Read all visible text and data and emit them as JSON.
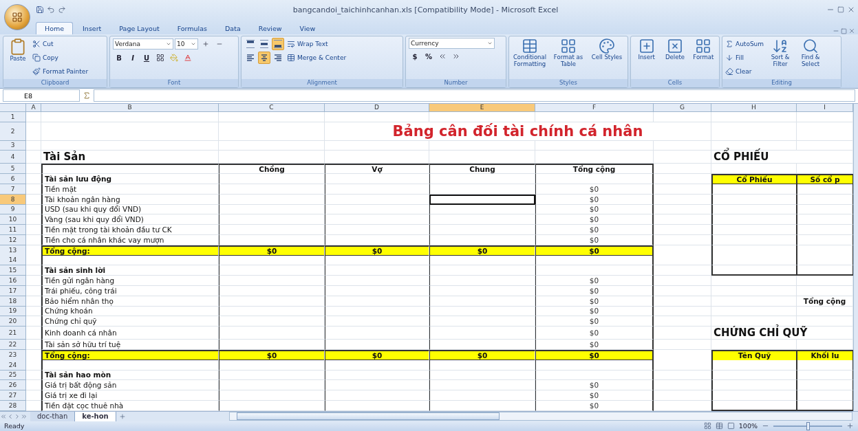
{
  "window": {
    "title": "bangcandoi_taichinhcanhan.xls  [Compatibility Mode] - Microsoft Excel"
  },
  "ribbon": {
    "tabs": [
      {
        "label": "Home",
        "selected": true
      },
      {
        "label": "Insert",
        "selected": false
      },
      {
        "label": "Page Layout",
        "selected": false
      },
      {
        "label": "Formulas",
        "selected": false
      },
      {
        "label": "Data",
        "selected": false
      },
      {
        "label": "Review",
        "selected": false
      },
      {
        "label": "View",
        "selected": false
      }
    ],
    "groups": [
      {
        "kind": "clipboard",
        "label": "Clipboard",
        "large": [
          "Paste"
        ],
        "small": [
          "Cut",
          "Copy",
          "Format Painter"
        ]
      },
      {
        "kind": "font",
        "label": "Font",
        "font": "Verdana",
        "size": "10",
        "styles": [
          "B",
          "I",
          "U"
        ]
      },
      {
        "kind": "alignment",
        "label": "Alignment",
        "vertical": [
          {
            "selected": false
          },
          {
            "selected": false
          },
          {
            "selected": true
          }
        ],
        "horizontal": [
          {
            "selected": false
          },
          {
            "selected": true
          },
          {
            "selected": false
          }
        ],
        "small": [
          "Wrap Text",
          "Merge & Center"
        ]
      },
      {
        "kind": "number",
        "label": "Number",
        "format": "Currency",
        "symbols": [
          "$",
          "%"
        ]
      },
      {
        "kind": "styles",
        "label": "Styles",
        "large": [
          "Conditional Formatting",
          "Format as Table",
          "Cell Styles"
        ]
      },
      {
        "kind": "cells",
        "label": "Cells",
        "large": [
          "Insert",
          "Delete",
          "Format"
        ]
      },
      {
        "kind": "editing",
        "label": "Editing",
        "small": [
          "AutoSum",
          "Fill",
          "Clear"
        ],
        "large": [
          "Sort & Filter",
          "Find & Select"
        ]
      }
    ]
  },
  "formula_bar": {
    "name_box": "E8"
  },
  "columns": [
    {
      "label": "A",
      "selected": false
    },
    {
      "label": "B",
      "selected": false
    },
    {
      "label": "C",
      "selected": false
    },
    {
      "label": "D",
      "selected": false
    },
    {
      "label": "E",
      "selected": true
    },
    {
      "label": "F",
      "selected": false
    },
    {
      "label": "G",
      "selected": false
    },
    {
      "label": "H",
      "selected": false
    },
    {
      "label": "I",
      "selected": false
    }
  ],
  "rows": [
    {
      "number": "1",
      "selected": false,
      "side_frame": false,
      "cells": {}
    },
    {
      "number": "2",
      "selected": false,
      "side_frame": false,
      "cells": {
        "d": {
          "text": "Bảng cân đối tài chính cá nhân",
          "kind": "title"
        }
      }
    },
    {
      "number": "3",
      "selected": false,
      "side_frame": false,
      "cells": {}
    },
    {
      "number": "4",
      "selected": false,
      "side_frame": false,
      "cells": {
        "b": {
          "text": "Tài Sản",
          "kind": "heading"
        },
        "h": {
          "text": "CỔ PHIẾU",
          "kind": "side_heading"
        }
      }
    },
    {
      "number": "5",
      "selected": false,
      "side_frame": false,
      "cells": {
        "c": {
          "text": "Chồng",
          "kind": "col_header"
        },
        "d": {
          "text": "Vợ",
          "kind": "col_header"
        },
        "e": {
          "text": "Chung",
          "kind": "col_header"
        },
        "f": {
          "text": "Tổng cộng",
          "kind": "col_header"
        }
      }
    },
    {
      "number": "6",
      "selected": false,
      "side_frame": false,
      "cells": {
        "b": {
          "text": "Tài sản lưu động",
          "kind": "section"
        },
        "h": {
          "text": "Cổ Phiếu",
          "kind": "side_header"
        },
        "i": {
          "text": "Số cổ p",
          "kind": "side_header"
        }
      }
    },
    {
      "number": "7",
      "selected": false,
      "side_frame": true,
      "cells": {
        "b": {
          "text": "Tiền mặt",
          "kind": "label"
        },
        "f": {
          "text": "$0",
          "kind": "value"
        }
      }
    },
    {
      "number": "8",
      "selected": true,
      "side_frame": true,
      "cells": {
        "b": {
          "text": "Tài khoản ngân hàng",
          "kind": "label"
        },
        "f": {
          "text": "$0",
          "kind": "value"
        }
      }
    },
    {
      "number": "9",
      "selected": false,
      "side_frame": true,
      "cells": {
        "b": {
          "text": "USD (sau khi quy đổi VND)",
          "kind": "label"
        },
        "f": {
          "text": "$0",
          "kind": "value"
        }
      }
    },
    {
      "number": "10",
      "selected": false,
      "side_frame": true,
      "cells": {
        "b": {
          "text": "Vàng (sau khi quy đổi VND)",
          "kind": "label"
        },
        "f": {
          "text": "$0",
          "kind": "value"
        }
      }
    },
    {
      "number": "11",
      "selected": false,
      "side_frame": true,
      "cells": {
        "b": {
          "text": "Tiền mặt trong tài khoản đầu tư CK",
          "kind": "label"
        },
        "f": {
          "text": "$0",
          "kind": "value"
        }
      }
    },
    {
      "number": "12",
      "selected": false,
      "side_frame": true,
      "cells": {
        "b": {
          "text": "Tiền cho cá nhân khác vay mượn",
          "kind": "label"
        },
        "f": {
          "text": "$0",
          "kind": "value"
        }
      }
    },
    {
      "number": "13",
      "selected": false,
      "side_frame": true,
      "cells": {
        "b": {
          "text": "Tổng cộng:",
          "kind": "total_label"
        },
        "c": {
          "text": "$0",
          "kind": "total_value"
        },
        "d": {
          "text": "$0",
          "kind": "total_value"
        },
        "e": {
          "text": "$0",
          "kind": "total_value"
        },
        "f": {
          "text": "$0",
          "kind": "total_value"
        }
      }
    },
    {
      "number": "14",
      "selected": false,
      "side_frame": true,
      "cells": {}
    },
    {
      "number": "15",
      "selected": false,
      "side_frame": true,
      "cells": {
        "b": {
          "text": "Tài sản sinh lời",
          "kind": "section"
        }
      }
    },
    {
      "number": "16",
      "selected": false,
      "side_frame": false,
      "cells": {
        "b": {
          "text": "Tiền gửi ngân hàng",
          "kind": "label"
        },
        "f": {
          "text": "$0",
          "kind": "value"
        }
      }
    },
    {
      "number": "17",
      "selected": false,
      "side_frame": false,
      "cells": {
        "b": {
          "text": "Trái phiếu, công trái",
          "kind": "label"
        },
        "f": {
          "text": "$0",
          "kind": "value"
        }
      }
    },
    {
      "number": "18",
      "selected": false,
      "side_frame": false,
      "cells": {
        "b": {
          "text": "Bảo hiểm nhân thọ",
          "kind": "label"
        },
        "f": {
          "text": "$0",
          "kind": "value"
        },
        "i": {
          "text": "Tổng cộng",
          "kind": "side_label"
        }
      }
    },
    {
      "number": "19",
      "selected": false,
      "side_frame": false,
      "cells": {
        "b": {
          "text": "Chứng khoán",
          "kind": "label"
        },
        "f": {
          "text": "$0",
          "kind": "value"
        }
      }
    },
    {
      "number": "20",
      "selected": false,
      "side_frame": false,
      "cells": {
        "b": {
          "text": "Chứng chỉ quỹ",
          "kind": "label"
        },
        "f": {
          "text": "$0",
          "kind": "value"
        }
      }
    },
    {
      "number": "21",
      "selected": false,
      "side_frame": false,
      "cells": {
        "b": {
          "text": "Kinh doanh cá nhân",
          "kind": "label"
        },
        "f": {
          "text": "$0",
          "kind": "value"
        },
        "h": {
          "text": "CHỨNG CHỈ QUỸ",
          "kind": "side_heading"
        }
      }
    },
    {
      "number": "22",
      "selected": false,
      "side_frame": false,
      "cells": {
        "b": {
          "text": "Tài sản sở hữu trí tuệ",
          "kind": "label"
        },
        "f": {
          "text": "$0",
          "kind": "value"
        }
      }
    },
    {
      "number": "23",
      "selected": false,
      "side_frame": false,
      "cells": {
        "b": {
          "text": "Tổng cộng:",
          "kind": "total_label"
        },
        "c": {
          "text": "$0",
          "kind": "total_value"
        },
        "d": {
          "text": "$0",
          "kind": "total_value"
        },
        "e": {
          "text": "$0",
          "kind": "total_value"
        },
        "f": {
          "text": "$0",
          "kind": "total_value"
        },
        "h": {
          "text": "Tên Quỹ",
          "kind": "side_header"
        },
        "i": {
          "text": "Khối lu",
          "kind": "side_header"
        }
      }
    },
    {
      "number": "24",
      "selected": false,
      "side_frame": true,
      "cells": {}
    },
    {
      "number": "25",
      "selected": false,
      "side_frame": true,
      "cells": {
        "b": {
          "text": "Tài sản hao mòn",
          "kind": "section"
        }
      }
    },
    {
      "number": "26",
      "selected": false,
      "side_frame": true,
      "cells": {
        "b": {
          "text": "Giá trị bất động sản",
          "kind": "label"
        },
        "f": {
          "text": "$0",
          "kind": "value"
        }
      }
    },
    {
      "number": "27",
      "selected": false,
      "side_frame": true,
      "cells": {
        "b": {
          "text": "Giá trị xe đi lại",
          "kind": "label"
        },
        "f": {
          "text": "$0",
          "kind": "value"
        }
      }
    },
    {
      "number": "28",
      "selected": false,
      "side_frame": true,
      "cells": {
        "b": {
          "text": "Tiền đặt cọc thuê nhà",
          "kind": "label"
        },
        "f": {
          "text": "$0",
          "kind": "value"
        }
      }
    }
  ],
  "sheet_tabs": [
    {
      "label": "doc-than",
      "selected": false
    },
    {
      "label": "ke-hon",
      "selected": true
    }
  ],
  "status_bar": {
    "status": "Ready",
    "zoom": "100%",
    "zoom_slider": {
      "level": 0.5
    }
  }
}
